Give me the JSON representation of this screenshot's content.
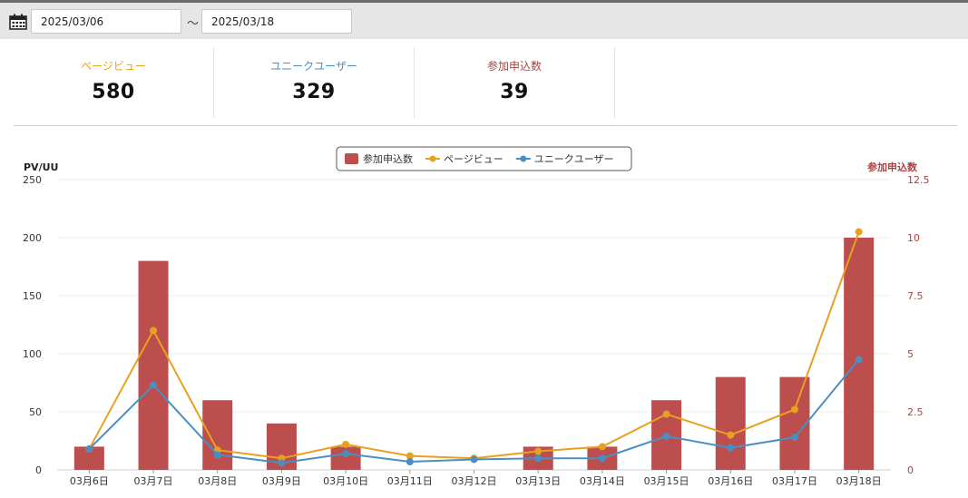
{
  "toolbar": {
    "date_from": "2025/03/06",
    "separator": "〜",
    "date_to": "2025/03/18"
  },
  "stats": [
    {
      "label": "ページビュー",
      "value": "580",
      "color": "#e8a317"
    },
    {
      "label": "ユニークユーザー",
      "value": "329",
      "color": "#4a8fc4"
    },
    {
      "label": "参加申込数",
      "value": "39",
      "color": "#b04040"
    }
  ],
  "chart_data": {
    "type": "bar",
    "categories": [
      "03月6日",
      "03月7日",
      "03月8日",
      "03月9日",
      "03月10日",
      "03月11日",
      "03月12日",
      "03月13日",
      "03月14日",
      "03月15日",
      "03月16日",
      "03月17日",
      "03月18日"
    ],
    "left_axis": {
      "label": "PV/UU",
      "ylim": [
        0,
        250
      ],
      "ticks": [
        "0",
        "50",
        "100",
        "150",
        "200",
        "250"
      ]
    },
    "right_axis": {
      "label": "参加申込数",
      "ylim": [
        0,
        12.5
      ],
      "ticks": [
        "0",
        "2.5",
        "5",
        "7.5",
        "10",
        "12.5"
      ],
      "color": "#b04040"
    },
    "grid": true,
    "legend": "top-center",
    "series": [
      {
        "name": "参加申込数",
        "kind": "bar",
        "axis": "right",
        "color": "#bc4e4e",
        "values": [
          1,
          9,
          3,
          2,
          1,
          0,
          0,
          1,
          1,
          3,
          4,
          4,
          10
        ]
      },
      {
        "name": "ページビュー",
        "kind": "line",
        "axis": "left",
        "color": "#e8a020",
        "values": [
          18,
          120,
          17,
          10,
          22,
          12,
          10,
          16,
          20,
          48,
          30,
          52,
          205
        ]
      },
      {
        "name": "ユニークユーザー",
        "kind": "line",
        "axis": "left",
        "color": "#4a8fc4",
        "values": [
          18,
          73,
          13,
          6,
          14,
          7,
          9,
          10,
          10,
          29,
          19,
          28,
          95
        ]
      }
    ]
  }
}
